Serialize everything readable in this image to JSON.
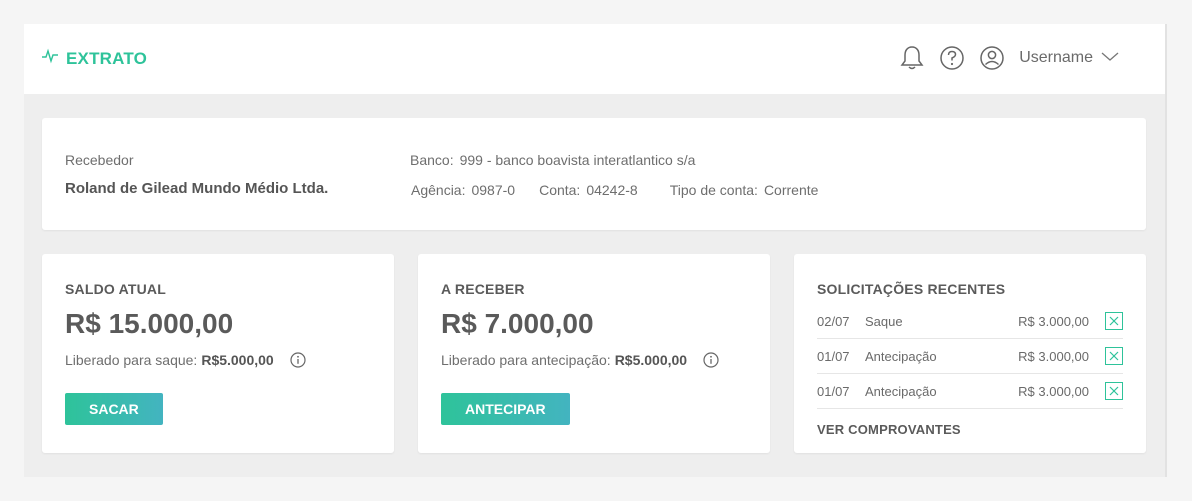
{
  "header": {
    "title": "EXTRATO",
    "username": "Username",
    "icons": [
      "pulse-icon",
      "bell-icon",
      "help-icon",
      "user-icon",
      "chevron-down-icon"
    ]
  },
  "info": {
    "recebedor_label": "Recebedor",
    "recebedor_name": "Roland de Gilead Mundo Médio Ltda.",
    "banco_label": "Banco:",
    "banco_value": "999 - banco boavista interatlantico s/a",
    "agencia_label": "Agência:",
    "agencia_value": "0987-0",
    "conta_label": "Conta:",
    "conta_value": "04242-8",
    "tipo_label": "Tipo de conta:",
    "tipo_value": "Corrente"
  },
  "saldo": {
    "title": "SALDO ATUAL",
    "value": "R$ 15.000,00",
    "liberado_label": "Liberado para saque:",
    "liberado_value": "R$5.000,00",
    "button": "SACAR"
  },
  "receber": {
    "title": "A RECEBER",
    "value": "R$ 7.000,00",
    "liberado_label": "Liberado para antecipação:",
    "liberado_value": "R$5.000,00",
    "button": "ANTECIPAR"
  },
  "solicitacoes": {
    "title": "SOLICITAÇÕES RECENTES",
    "rows": [
      {
        "date": "02/07",
        "type": "Saque",
        "amount": "R$ 3.000,00"
      },
      {
        "date": "01/07",
        "type": "Antecipação",
        "amount": "R$ 3.000,00"
      },
      {
        "date": "01/07",
        "type": "Antecipação",
        "amount": "R$ 3.000,00"
      }
    ],
    "link": "VER COMPROVANTES"
  },
  "colors": {
    "accent": "#2ec39a",
    "accent_gradient_end": "#43b4c0",
    "background": "#eeeeee"
  }
}
